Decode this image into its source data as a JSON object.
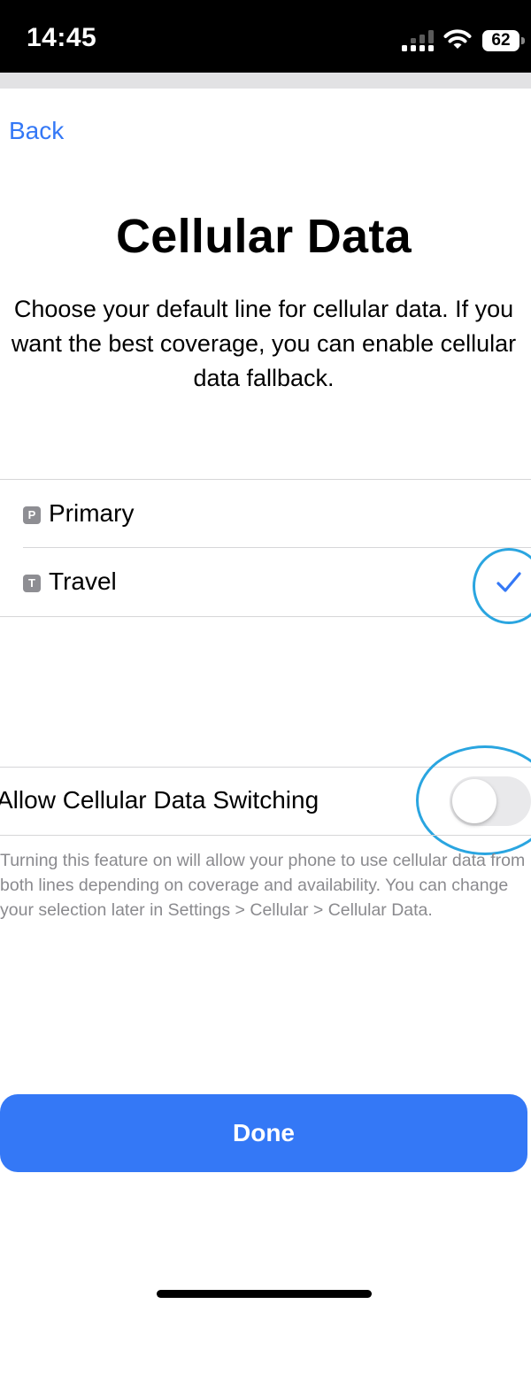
{
  "status_bar": {
    "time": "14:45",
    "battery_level": "62",
    "signal_icon": "cellular-signal-icon",
    "wifi_icon": "wifi-icon"
  },
  "nav": {
    "back_label": "Back"
  },
  "header": {
    "title": "Cellular Data",
    "description": "Choose your default line for cellular data. If you want the best coverage, you can enable cellular data fallback."
  },
  "lines": [
    {
      "badge": "P",
      "label": "Primary",
      "selected": false
    },
    {
      "badge": "T",
      "label": "Travel",
      "selected": true
    }
  ],
  "switching": {
    "label": "Allow Cellular Data Switching",
    "enabled": false,
    "footnote": "Turning this feature on will allow your phone to use cellular data from both lines depending on coverage and availability. You can change your selection later in Settings > Cellular > Cellular Data."
  },
  "actions": {
    "done_label": "Done"
  },
  "colors": {
    "accent": "#3478f6",
    "annotation": "#2aa5e0",
    "secondary_text": "#8a8a8e"
  }
}
